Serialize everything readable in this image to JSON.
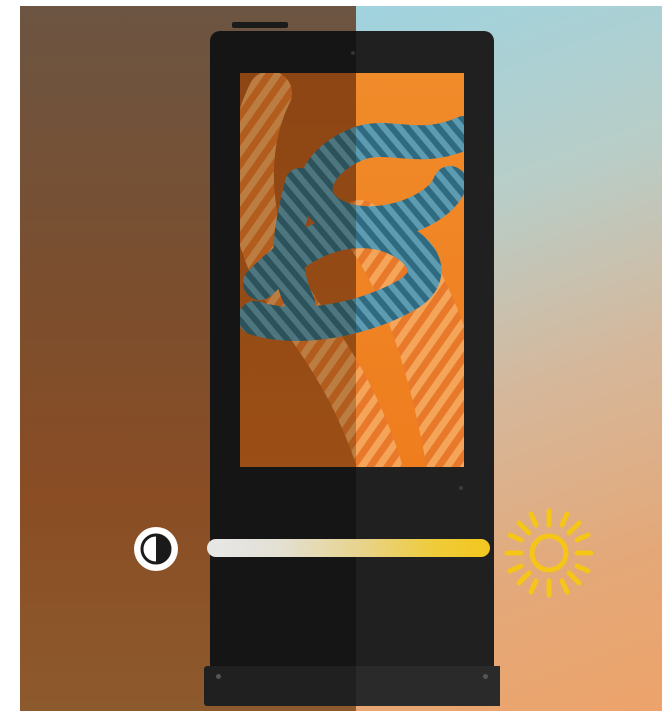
{
  "colors": {
    "sun_accent": "#f5c518",
    "bar_start": "#e7e7e7",
    "bar_end": "#f3c71e",
    "kiosk_body": "#151515"
  },
  "brightness_slider": {
    "level": 1.0,
    "icon_left": "contrast-icon",
    "icon_right": "sun-icon"
  },
  "screen_content": {
    "subject": "rope-knot-image"
  }
}
